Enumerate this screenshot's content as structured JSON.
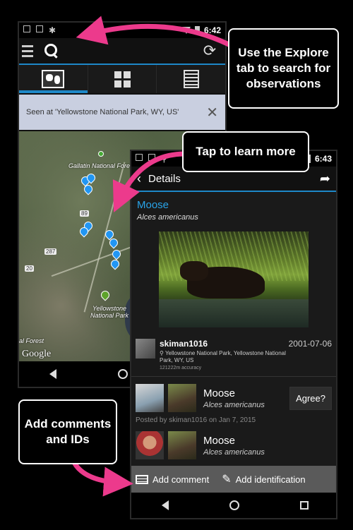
{
  "colors": {
    "accent": "#1e88c8",
    "link_blue": "#29a3e8",
    "arrow_pink": "#ec3a8c"
  },
  "explore_screen": {
    "status_time": "6:42",
    "tabs": [
      {
        "icon": "map-icon",
        "active": true
      },
      {
        "icon": "grid-icon",
        "active": false
      },
      {
        "icon": "list-icon",
        "active": false
      }
    ],
    "seen_at": "Seen at 'Yellowstone National Park, WY, US'",
    "map": {
      "labels": {
        "gallatin": "Gallatin National Forest",
        "yellowstone": "Yellowstone National Park",
        "forest": "al Forest"
      },
      "highways": {
        "h89": "89",
        "h287": "287",
        "h20": "20"
      },
      "attribution": "Google"
    }
  },
  "details_screen": {
    "status_time": "6:43",
    "title": "Details",
    "taxon": {
      "common": "Moose",
      "scientific": "Alces americanus"
    },
    "observation": {
      "user": "skiman1016",
      "date": "2001-07-06",
      "place": "Yellowstone National Park, Yellowstone National Park, WY, US",
      "accuracy": "121222m accuracy"
    },
    "identifications": [
      {
        "common": "Moose",
        "scientific": "Alces americanus",
        "posted": "Posted by skiman1016 on Jan 7, 2015",
        "agree_label": "Agree?"
      },
      {
        "common": "Moose",
        "scientific": "Alces americanus"
      }
    ],
    "actions": {
      "comment": "Add comment",
      "identify": "Add identification"
    }
  },
  "callouts": {
    "explore": "Use the Explore tab to search for observations",
    "learn": "Tap to learn more",
    "comments": "Add comments and IDs"
  }
}
